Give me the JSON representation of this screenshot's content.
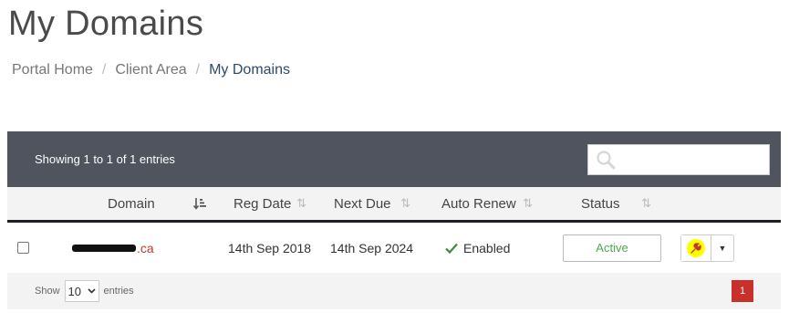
{
  "page": {
    "title": "My Domains"
  },
  "breadcrumb": {
    "items": [
      "Portal Home",
      "Client Area",
      "My Domains"
    ],
    "separator": "/"
  },
  "table": {
    "info": "Showing 1 to 1 of 1 entries",
    "search": {
      "value": "",
      "placeholder": "",
      "icon": "search-icon"
    },
    "columns": [
      "Domain",
      "Reg Date",
      "Next Due",
      "Auto Renew",
      "Status"
    ],
    "rows": [
      {
        "domain_visible": ".ca",
        "reg_date": "14th Sep 2018",
        "next_due": "14th Sep 2024",
        "auto_renew": "Enabled",
        "status": "Active"
      }
    ],
    "footer": {
      "show_label": "Show",
      "entries_label": "entries",
      "page_length": "10",
      "current_page": "1"
    }
  },
  "colors": {
    "accent": "#2c4a6b",
    "status_active": "#4cae4c",
    "toolbar_bg": "#4f545f",
    "link": "#c0392b",
    "pagination": "#c9302c",
    "wrench": "#ffff00"
  }
}
